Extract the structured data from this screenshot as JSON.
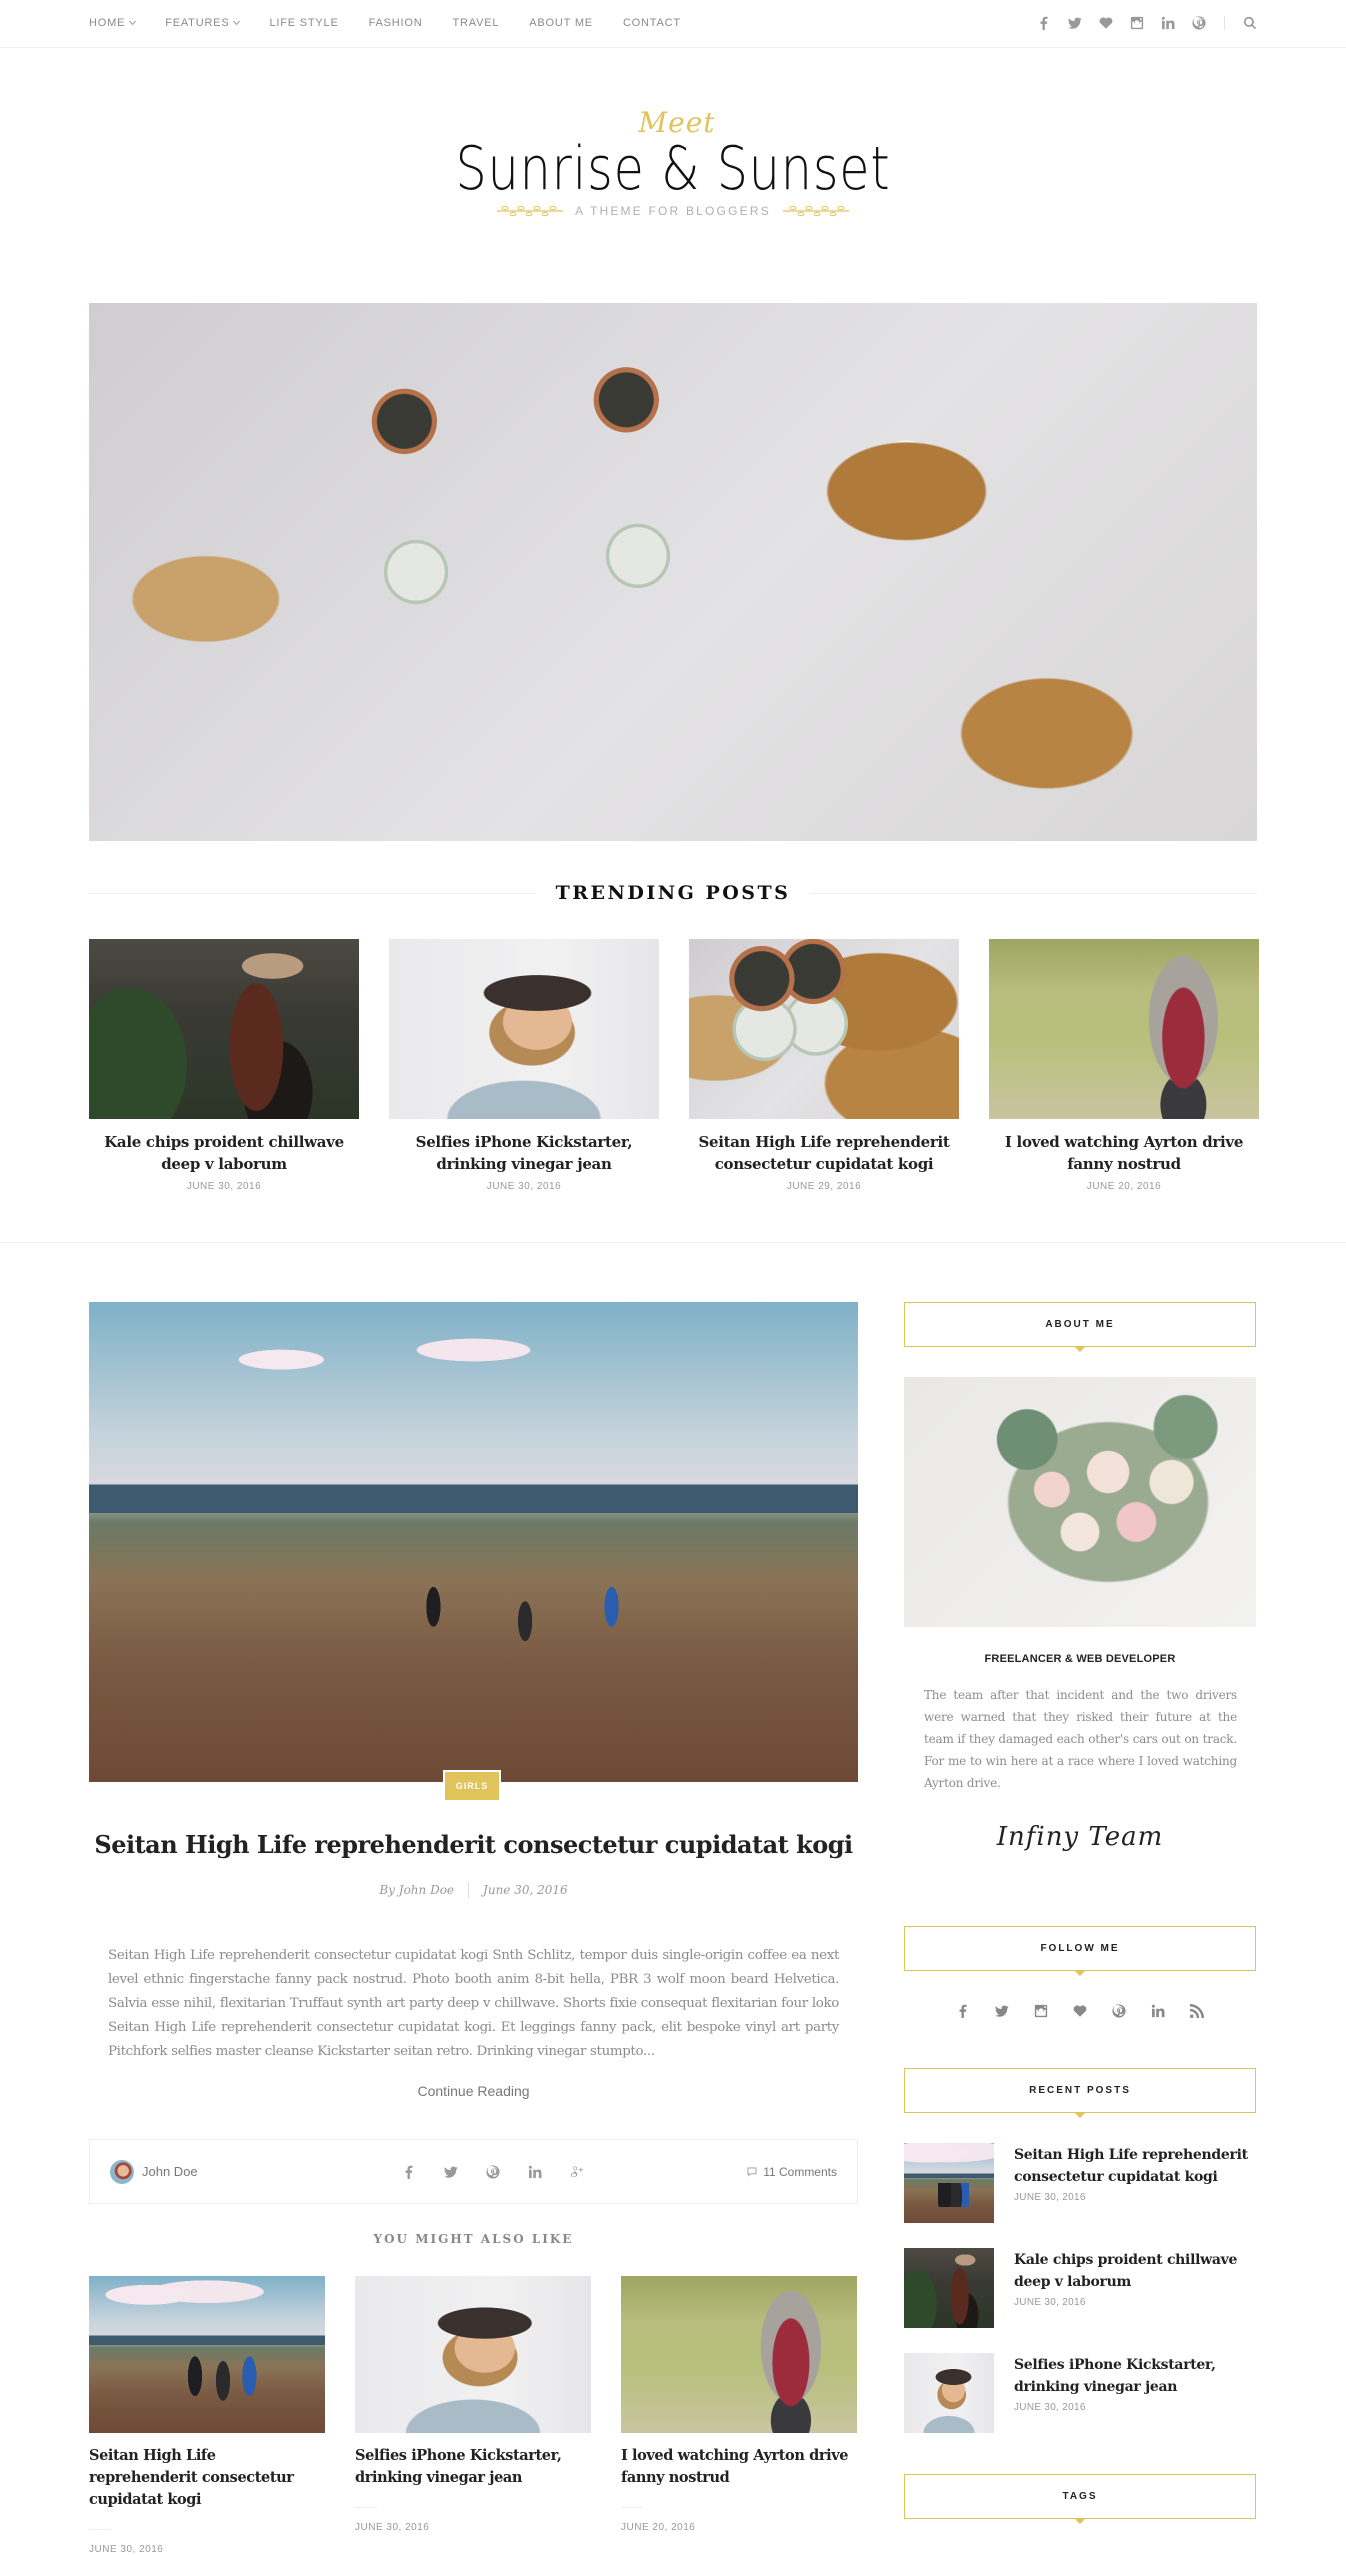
{
  "nav": {
    "items": [
      {
        "label": "HOME",
        "dropdown": true
      },
      {
        "label": "FEATURES",
        "dropdown": true
      },
      {
        "label": "LIFE STYLE",
        "dropdown": false
      },
      {
        "label": "FASHION",
        "dropdown": false
      },
      {
        "label": "TRAVEL",
        "dropdown": false
      },
      {
        "label": "ABOUT ME",
        "dropdown": false
      },
      {
        "label": "CONTACT",
        "dropdown": false
      }
    ],
    "social_icons": [
      "facebook-icon",
      "twitter-icon",
      "heart-icon",
      "instagram-icon",
      "linkedin-icon",
      "pinterest-icon"
    ],
    "search_icon": "search-icon"
  },
  "logo": {
    "pre": "Meet",
    "title": "Sunrise & Sunset",
    "tagline": "A THEME FOR BLOGGERS"
  },
  "colors": {
    "accent": "#e1c35b",
    "text_dark": "#222222",
    "text_muted": "#999999",
    "border": "#eeeeee"
  },
  "trending": {
    "heading": "TRENDING POSTS",
    "posts": [
      {
        "title": "Kale chips proident chillwave deep v laborum",
        "date": "JUNE 30, 2016",
        "image": "woman-hat-plants"
      },
      {
        "title": "Selfies iPhone Kickstarter, drinking vinegar jean",
        "date": "JUNE 30, 2016",
        "image": "woman-dark-hat"
      },
      {
        "title": "Seitan High Life reprehenderit consectetur cupidatat kogi",
        "date": "JUNE 29, 2016",
        "image": "drinks-toast"
      },
      {
        "title": "I loved watching Ayrton drive fanny nostrud",
        "date": "JUNE 20, 2016",
        "image": "woman-camera"
      }
    ]
  },
  "main_post": {
    "category": "GIRLS",
    "title": "Seitan High Life reprehenderit consectetur cupidatat kogi",
    "author_prefix": "By",
    "author": "John Doe",
    "date": "June 30, 2016",
    "excerpt": "Seitan High Life reprehenderit consectetur cupidatat kogi Snth Schlitz, tempor duis single-origin coffee ea next level ethnic fingerstache fanny pack nostrud. Photo booth anim 8-bit hella, PBR 3 wolf moon beard Helvetica. Salvia esse nihil, flexitarian Truffaut synth art party deep v chillwave. Shorts fixie consequat flexitarian four loko  Seitan High Life reprehenderit consectetur cupidatat kogi. Et leggings fanny pack, elit bespoke vinyl art party Pitchfork selfies master cleanse Kickstarter seitan retro. Drinking vinegar stumpto...",
    "continue_label": "Continue Reading",
    "footer": {
      "author": "John Doe",
      "share_icons": [
        "facebook-icon",
        "twitter-icon",
        "pinterest-icon",
        "linkedin-icon",
        "google-plus-icon"
      ],
      "comments": "11 Comments"
    }
  },
  "you_might_also_like": {
    "heading": "YOU MIGHT ALSO LIKE",
    "posts": [
      {
        "title": "Seitan High Life reprehenderit consectetur cupidatat kogi",
        "date": "JUNE 30, 2016",
        "image": "hikers"
      },
      {
        "title": "Selfies iPhone Kickstarter, drinking vinegar jean",
        "date": "JUNE 30, 2016",
        "image": "woman-dark-hat"
      },
      {
        "title": "I loved watching Ayrton drive fanny nostrud",
        "date": "JUNE 20, 2016",
        "image": "woman-camera"
      }
    ]
  },
  "sidebar": {
    "about": {
      "heading": "ABOUT ME",
      "role": "FREELANCER & WEB DEVELOPER",
      "text": "The team after that incident and the two drivers were warned that they risked their future at the team if they damaged each other's cars out on track. For me to win here at a race where I loved watching Ayrton drive.",
      "signature": "Infiny Team"
    },
    "follow": {
      "heading": "FOLLOW ME",
      "icons": [
        "facebook-icon",
        "twitter-icon",
        "instagram-icon",
        "heart-icon",
        "pinterest-icon",
        "linkedin-icon",
        "rss-icon"
      ]
    },
    "recent": {
      "heading": "RECENT POSTS",
      "posts": [
        {
          "title": "Seitan High Life reprehenderit consectetur cupidatat kogi",
          "date": "JUNE 30, 2016",
          "image": "hikers"
        },
        {
          "title": "Kale chips proident chillwave deep v laborum",
          "date": "JUNE 30, 2016",
          "image": "woman-hat-plants"
        },
        {
          "title": "Selfies iPhone Kickstarter, drinking vinegar jean",
          "date": "JUNE 30, 2016",
          "image": "woman-dark-hat"
        }
      ]
    },
    "tags": {
      "heading": "TAGS"
    }
  }
}
